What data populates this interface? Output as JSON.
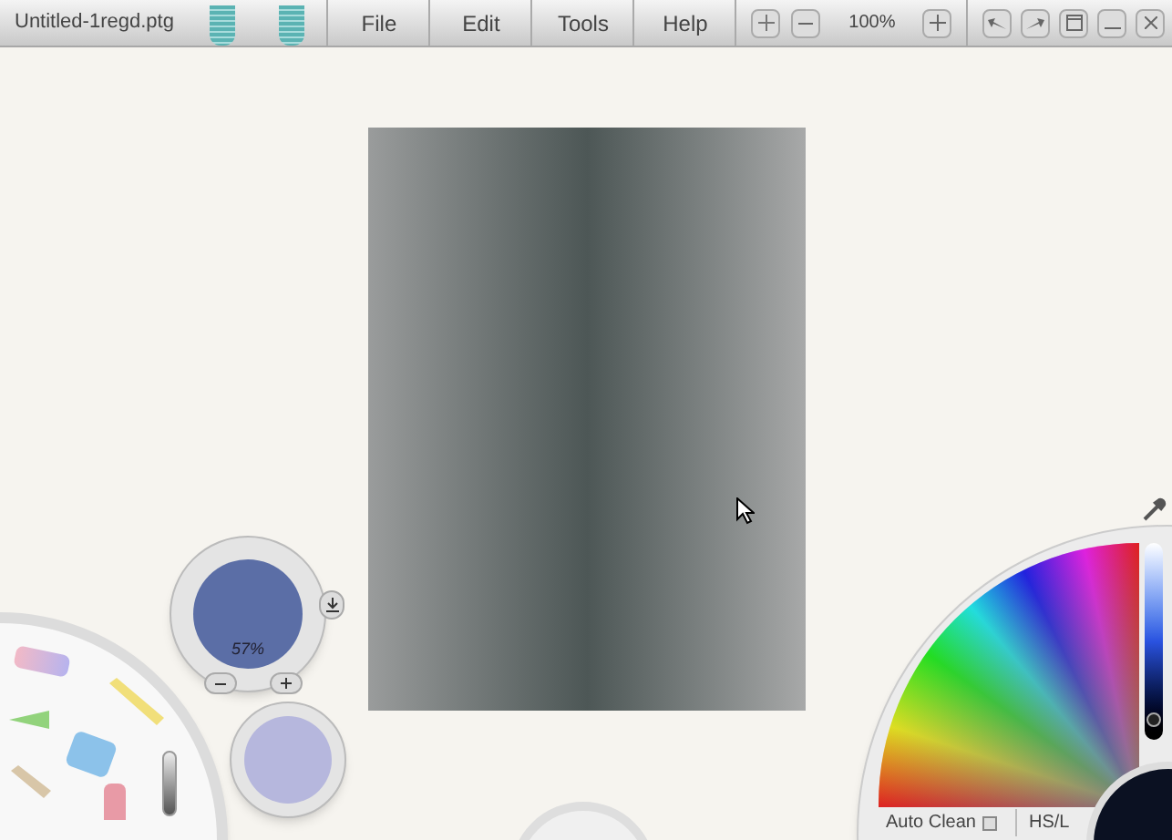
{
  "title_bar": {
    "file_name": "Untitled-1regd.ptg"
  },
  "menu": [
    {
      "label": "File"
    },
    {
      "label": "Edit"
    },
    {
      "label": "Tools"
    },
    {
      "label": "Help"
    }
  ],
  "zoom": {
    "value": "100%"
  },
  "color_preview": {
    "opacity": "57%"
  },
  "color_picker": {
    "auto_clean": {
      "label": "Auto Clean",
      "checked": false
    },
    "mode": "HS/L",
    "lightness": {
      "level": 0.1
    }
  }
}
